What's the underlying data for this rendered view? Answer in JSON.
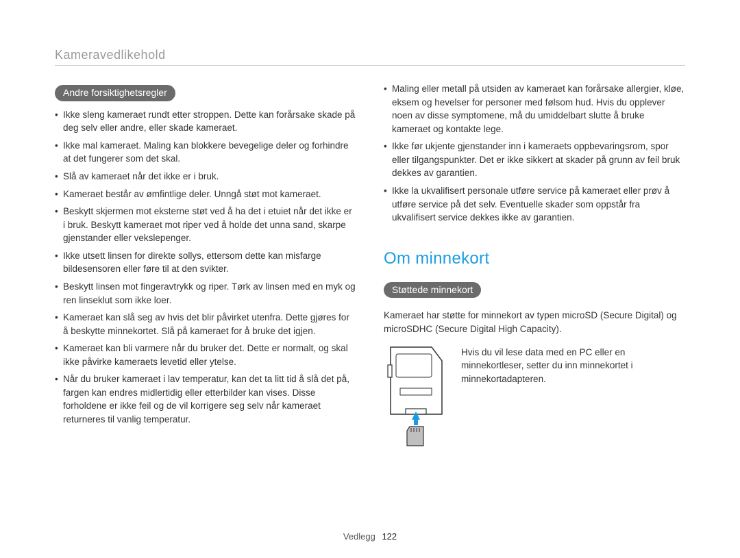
{
  "header": {
    "section": "Kameravedlikehold"
  },
  "left": {
    "pill": "Andre forsiktighetsregler",
    "items": [
      "Ikke sleng kameraet rundt etter stroppen. Dette kan forårsake skade på deg selv eller andre, eller skade kameraet.",
      "Ikke mal kameraet. Maling kan blokkere bevegelige deler og forhindre at det fungerer som det skal.",
      "Slå av kameraet når det ikke er i bruk.",
      "Kameraet består av ømfintlige deler. Unngå støt mot kameraet.",
      "Beskytt skjermen mot eksterne støt ved å ha det i etuiet når det ikke er i bruk. Beskytt kameraet mot riper ved å holde det unna sand, skarpe gjenstander eller vekslepenger.",
      "Ikke utsett linsen for direkte sollys, ettersom dette kan misfarge bildesensoren eller føre til at den svikter.",
      "Beskytt linsen mot fingeravtrykk og riper. Tørk av linsen med en myk og ren linseklut som ikke loer.",
      "Kameraet kan slå seg av hvis det blir påvirket utenfra. Dette gjøres for å beskytte minnekortet. Slå på kameraet for å bruke det igjen.",
      "Kameraet kan bli varmere når du bruker det. Dette er normalt, og skal ikke påvirke kameraets levetid eller ytelse.",
      "Når du bruker kameraet i lav temperatur, kan det ta litt tid å slå det på, fargen kan endres midlertidig eller etterbilder kan vises. Disse forholdene er ikke feil og de vil korrigere seg selv når kameraet returneres til vanlig temperatur."
    ]
  },
  "rightTop": {
    "items": [
      "Maling eller metall på utsiden av kameraet kan forårsake allergier, kløe, eksem og hevelser for personer med følsom hud. Hvis du opplever noen av disse symptomene, må du umiddelbart slutte å bruke kameraet og kontakte lege.",
      "Ikke før ukjente gjenstander inn i kameraets oppbevaringsrom, spor eller tilgangspunkter. Det er ikke sikkert at skader på grunn av feil bruk dekkes av garantien.",
      "Ikke la ukvalifisert personale utføre service på kameraet eller prøv å utføre service på det selv. Eventuelle skader som oppstår fra ukvalifisert service dekkes ikke av garantien."
    ]
  },
  "memory": {
    "title": "Om minnekort",
    "pill": "Støttede minnekort",
    "intro": "Kameraet har støtte for minnekort av typen microSD (Secure Digital) og microSDHC (Secure Digital High Capacity).",
    "adapterNote": "Hvis du vil lese data med en PC eller en minnekortleser, setter du inn minnekortet i minnekortadapteren."
  },
  "footer": {
    "label": "Vedlegg",
    "page": "122"
  }
}
